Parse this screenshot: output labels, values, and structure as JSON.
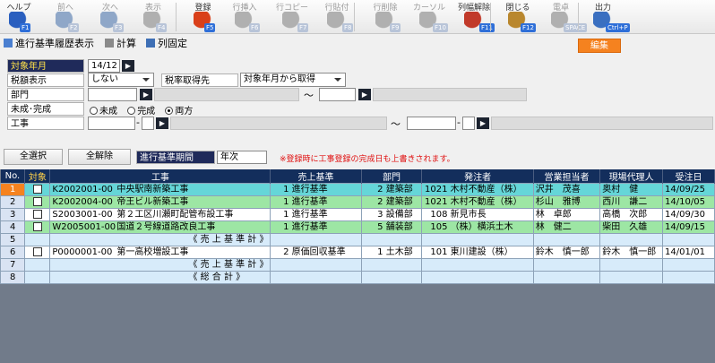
{
  "toolbar": {
    "items": [
      {
        "label": "ヘルプ",
        "key": "F1",
        "icon": "help-icon",
        "enabled": true
      },
      {
        "label": "前へ",
        "key": "F2",
        "icon": "back-arrow-icon",
        "enabled": false
      },
      {
        "label": "次へ",
        "key": "F3",
        "icon": "forward-arrow-icon",
        "enabled": false
      },
      {
        "label": "表示",
        "key": "F4",
        "icon": "search-icon",
        "enabled": false
      },
      {
        "label": "登録",
        "key": "F5",
        "icon": "register-icon",
        "enabled": true
      },
      {
        "label": "行挿入",
        "key": "F6",
        "icon": "row-insert-icon",
        "enabled": false
      },
      {
        "label": "行コピー",
        "key": "F7",
        "icon": "row-copy-icon",
        "enabled": false
      },
      {
        "label": "行貼付",
        "key": "F8",
        "icon": "row-paste-icon",
        "enabled": false
      },
      {
        "label": "行削除",
        "key": "F9",
        "icon": "row-delete-icon",
        "enabled": false
      },
      {
        "label": "カーソル",
        "key": "F10",
        "icon": "cursor-icon",
        "enabled": false
      },
      {
        "label": "列幅解除",
        "key": "F11",
        "icon": "column-width-icon",
        "enabled": true
      },
      {
        "label": "閉じる",
        "key": "F12",
        "icon": "close-door-icon",
        "enabled": true
      },
      {
        "label": "電卓",
        "key": "SPACE",
        "icon": "calculator-icon",
        "enabled": false
      },
      {
        "label": "出力",
        "key": "Ctrl+P",
        "icon": "printer-icon",
        "enabled": true
      }
    ]
  },
  "subtoolbar": {
    "history_label": "進行基準履歴表示",
    "calc_label": "計算",
    "fix_col_label": "列固定",
    "edit_label": "編集"
  },
  "form": {
    "target_month_label": "対象年月",
    "target_month_value": "14/12",
    "tax_display_label": "税額表示",
    "tax_display_value": "しない",
    "tax_rate_label": "税率取得先",
    "tax_rate_value": "対象年月から取得",
    "department_label": "部門",
    "range_sep": "～",
    "completion_label": "未成･完成",
    "radio_incomplete": "未成",
    "radio_complete": "完成",
    "radio_both": "両方",
    "construction_label": "工事",
    "dash": "-",
    "select_all": "全選択",
    "deselect_all": "全解除",
    "period_label": "進行基準期間",
    "period_value": "年次",
    "notice": "※登録時に工事登録の完成日も上書きされます。"
  },
  "grid": {
    "headers": [
      "No.",
      "対象",
      "工事",
      "売上基準",
      "部門",
      "発注者",
      "営業担当者",
      "現場代理人",
      "受注日"
    ],
    "rows": [
      {
        "no": "1",
        "check": true,
        "code": "K2002001-00",
        "name": "中央駅南新築工事",
        "sb_no": "1",
        "sb": "進行基準",
        "dept_no": "2",
        "dept": "建築部",
        "cust_no": "1021",
        "cust": "木村不動産（株）",
        "sales": "沢井　茂喜",
        "agent": "奥村　健",
        "date": "14/09/25",
        "cls": "r1"
      },
      {
        "no": "2",
        "check": true,
        "code": "K2002004-00",
        "name": "帝王ビル新築工事",
        "sb_no": "1",
        "sb": "進行基準",
        "dept_no": "2",
        "dept": "建築部",
        "cust_no": "1021",
        "cust": "木村不動産（株）",
        "sales": "杉山　雅博",
        "agent": "西川　謙二",
        "date": "14/10/05",
        "cls": "r2"
      },
      {
        "no": "3",
        "check": true,
        "code": "S2003001-00",
        "name": "第２工区川瀬町配管布設工事",
        "sb_no": "1",
        "sb": "進行基準",
        "dept_no": "3",
        "dept": "設備部",
        "cust_no": "108",
        "cust": "新見市長",
        "sales": "林　卓郎",
        "agent": "高橋　次郎",
        "date": "14/09/30",
        "cls": "r3"
      },
      {
        "no": "4",
        "check": true,
        "code": "W2005001-00",
        "name": "国道２号線道路改良工事",
        "sb_no": "1",
        "sb": "進行基準",
        "dept_no": "5",
        "dept": "舗装部",
        "cust_no": "105",
        "cust": "（株）横浜土木",
        "sales": "林　健二",
        "agent": "柴田　久雄",
        "date": "14/09/15",
        "cls": "r4"
      },
      {
        "no": "5",
        "check": null,
        "code": "",
        "name": "《 売 上 基 準 計 》",
        "sb_no": "",
        "sb": "",
        "dept_no": "",
        "dept": "",
        "cust_no": "",
        "cust": "",
        "sales": "",
        "agent": "",
        "date": "",
        "cls": "sum"
      },
      {
        "no": "6",
        "check": true,
        "code": "P0000001-00",
        "name": "第一高校増設工事",
        "sb_no": "2",
        "sb": "原価回収基準",
        "dept_no": "1",
        "dept": "土木部",
        "cust_no": "101",
        "cust": "東川建設（株）",
        "sales": "鈴木　慎一郎",
        "agent": "鈴木　慎一郎",
        "date": "14/01/01",
        "cls": "r6"
      },
      {
        "no": "7",
        "check": null,
        "code": "",
        "name": "《 売 上 基 準 計 》",
        "sb_no": "",
        "sb": "",
        "dept_no": "",
        "dept": "",
        "cust_no": "",
        "cust": "",
        "sales": "",
        "agent": "",
        "date": "",
        "cls": "sum"
      },
      {
        "no": "8",
        "check": null,
        "code": "",
        "name": "《 総 合 計 》",
        "sb_no": "",
        "sb": "",
        "dept_no": "",
        "dept": "",
        "cust_no": "",
        "cust": "",
        "sales": "",
        "agent": "",
        "date": "",
        "cls": "sum"
      }
    ]
  }
}
